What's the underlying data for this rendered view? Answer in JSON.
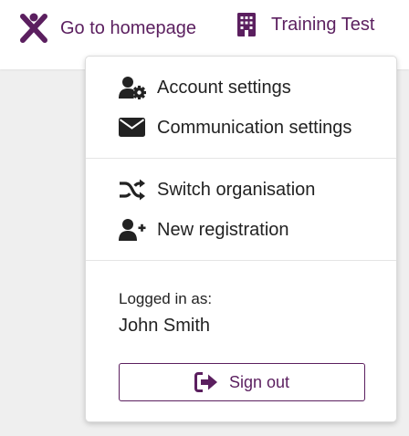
{
  "topbar": {
    "home": {
      "label": "Go to homepage",
      "icon": "person-star-logo-icon"
    },
    "organisation": {
      "label": "Training Test",
      "icon": "building-icon"
    },
    "accent_color": "#5b1f5f"
  },
  "menu": {
    "items": [
      {
        "label": "Account settings",
        "icon": "user-gear-icon"
      },
      {
        "label": "Communication settings",
        "icon": "envelope-icon"
      },
      {
        "label": "Switch organisation",
        "icon": "shuffle-icon"
      },
      {
        "label": "New registration",
        "icon": "user-plus-icon"
      }
    ],
    "logged_in_label": "Logged in as:",
    "user_name": "John Smith",
    "sign_out": {
      "label": "Sign out",
      "icon": "sign-out-icon"
    }
  }
}
